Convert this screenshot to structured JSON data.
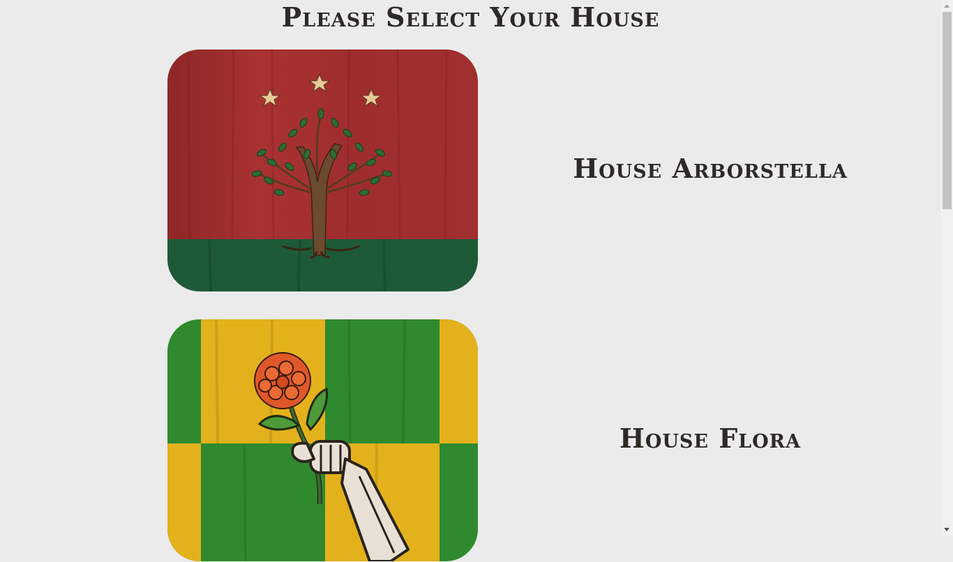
{
  "page": {
    "title": "Please Select Your House"
  },
  "houses": [
    {
      "name": "House Arborstella",
      "crest_icon": "tree-with-stars-crest-icon",
      "colors": [
        "#a32e2e",
        "#1e5a35"
      ]
    },
    {
      "name": "House Flora",
      "crest_icon": "skeleton-hand-flower-crest-icon",
      "colors": [
        "#2f8a2f",
        "#e7b41a",
        "#e0582a"
      ]
    }
  ],
  "scrollbar": {
    "position": 0.0
  }
}
